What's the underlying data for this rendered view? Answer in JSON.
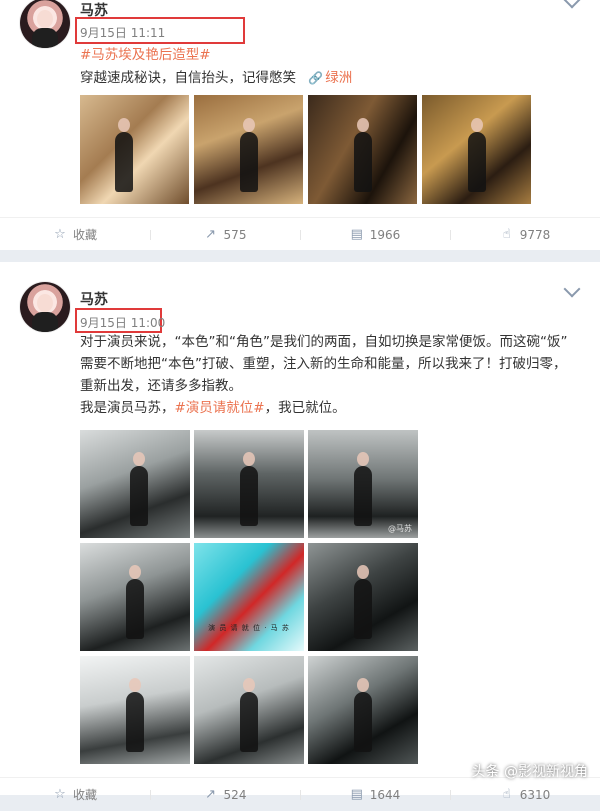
{
  "posts": [
    {
      "username": "马苏",
      "time": "9月15日 11:11",
      "topic": "#马苏埃及艳后造型#",
      "text": "穿越速成秘诀，自信抬头，记得憋笑",
      "link_label": "绿洲",
      "actions": {
        "favorite_label": "收藏",
        "repost_count": "575",
        "comment_count": "1966",
        "like_count": "9778"
      }
    },
    {
      "username": "马苏",
      "time": "9月15日 11:00",
      "paragraph_line1": "对于演员来说，“本色”和“角色”是我们的两面，自如切换是家常便饭。而这碗“饭”",
      "paragraph_line2": "需要不断地把“本色”打破、重塑，注入新的生命和能量，所以我来了！打破归零，",
      "paragraph_line3": "重新出发，还请多多指教。",
      "line4_prefix": "我是演员马苏，",
      "topic": "#演员请就位#",
      "line4_suffix": "，我已就位。",
      "photo_watermark": "@马苏",
      "art_caption": "演 员 请 就 位 · 马 苏",
      "actions": {
        "favorite_label": "收藏",
        "repost_count": "524",
        "comment_count": "1644",
        "like_count": "6310"
      }
    }
  ],
  "watermark": "头条 @影视新视角",
  "icons": {
    "favorite": "star-icon",
    "repost": "repost-icon",
    "comment": "comment-icon",
    "like": "thumbs-up-icon",
    "link": "link-icon",
    "menu": "chevron-down-icon"
  },
  "colors": {
    "highlight": "#e03a3a",
    "topic": "#eb7350",
    "background": "#e9edf2"
  }
}
